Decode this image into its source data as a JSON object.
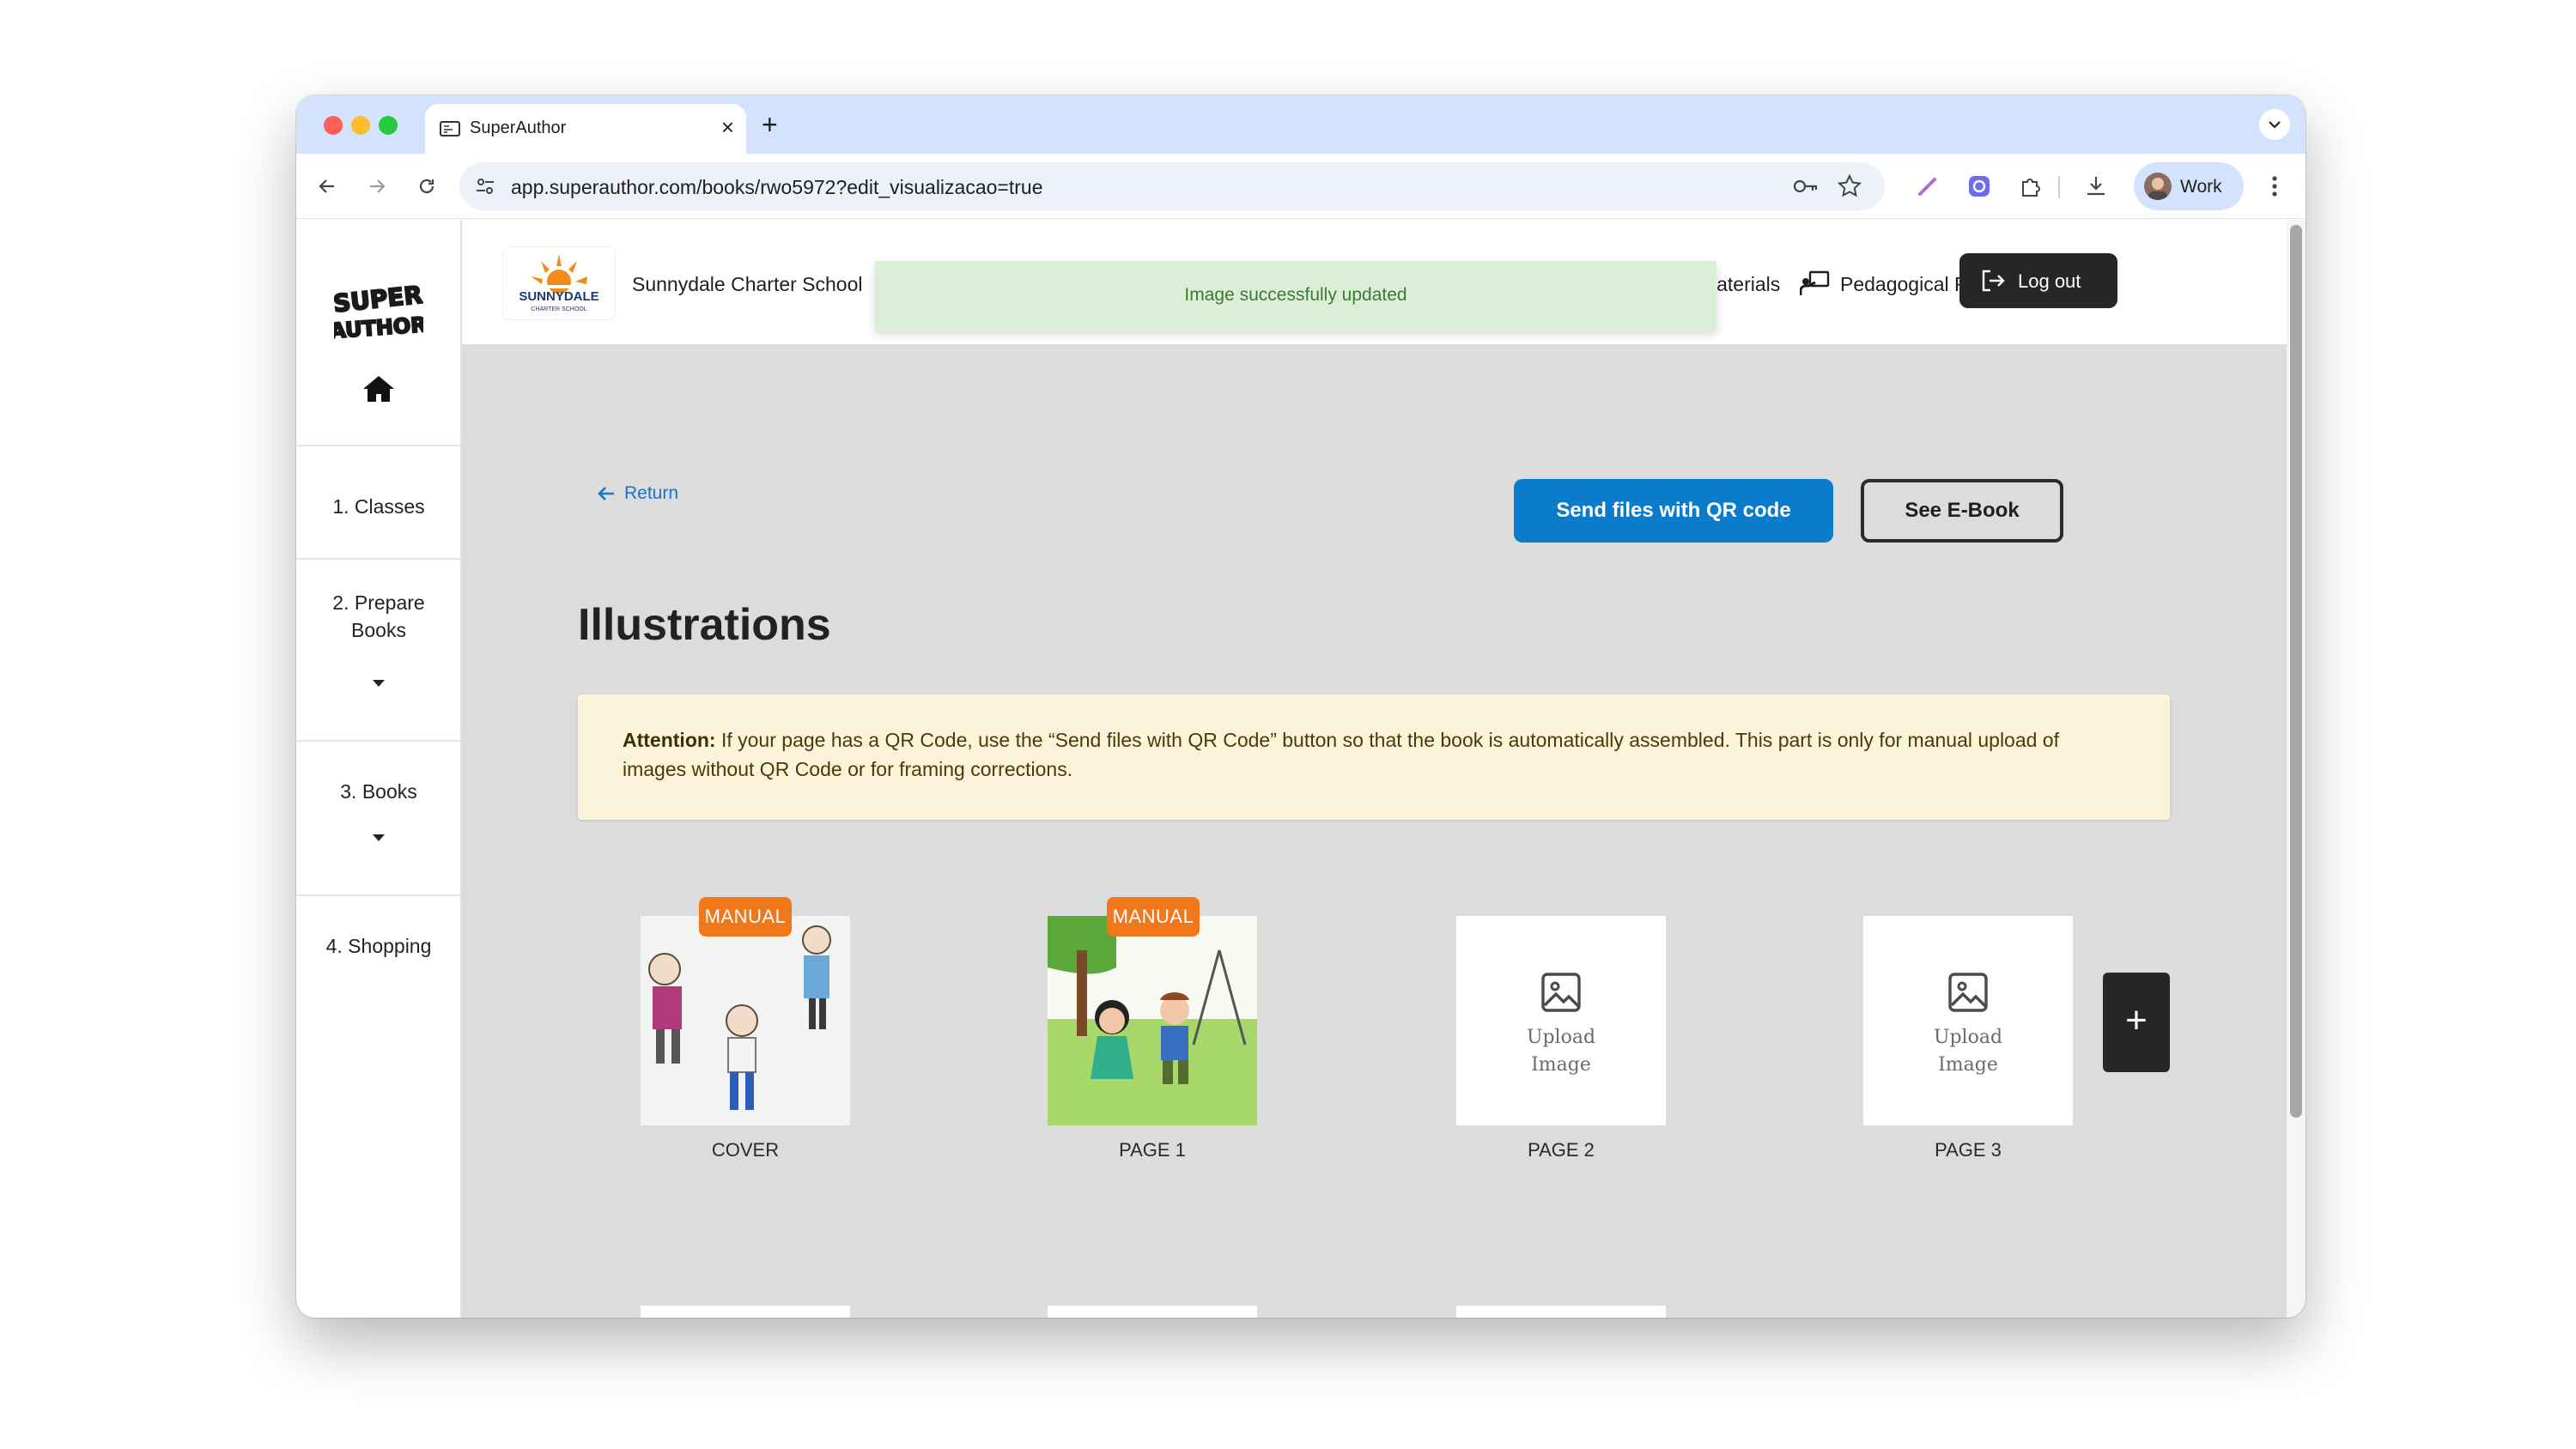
{
  "browser": {
    "tab_title": "SuperAuthor",
    "url": "app.superauthor.com/books/rwo5972?edit_visualizacao=true",
    "profile_label": "Work"
  },
  "sidebar": {
    "logo_text_top": "SUPER",
    "logo_text_bottom": "AUTHOR",
    "items": [
      {
        "label": "1. Classes"
      },
      {
        "label": "2. Prepare Books"
      },
      {
        "label": "3. Books"
      },
      {
        "label": "4. Shopping"
      }
    ]
  },
  "header": {
    "school_logo_text": "SUNNYDALE",
    "school_logo_subtext": "CHARTER SCHOOL",
    "school_name": "Sunnydale Charter School",
    "toast": "Image successfully updated",
    "materials_partial": "laterials",
    "pedagogical_resources": "Pedagogical Resources",
    "logout": "Log out"
  },
  "main": {
    "return_label": "Return",
    "send_qr_label": "Send files with QR code",
    "see_ebook_label": "See E-Book",
    "title": "Illustrations",
    "attention_bold": "Attention:",
    "attention_text": " If your page has a QR Code, use the “Send files with QR Code” button so that the book is automatically assembled. This part is only for manual upload of images without QR Code or for framing corrections.",
    "badge_label": "MANUAL",
    "upload_label": "Upload Image",
    "add_label": "+",
    "cards": [
      {
        "label": "COVER",
        "state": "manual"
      },
      {
        "label": "PAGE 1",
        "state": "manual"
      },
      {
        "label": "PAGE 2",
        "state": "empty"
      },
      {
        "label": "PAGE 3",
        "state": "empty"
      }
    ]
  },
  "colors": {
    "primary_blue": "#0a7ccb",
    "badge_orange": "#f0781a",
    "toast_green_bg": "#dcefd6",
    "attention_bg": "#fbf4da",
    "dark_button": "#262626"
  }
}
